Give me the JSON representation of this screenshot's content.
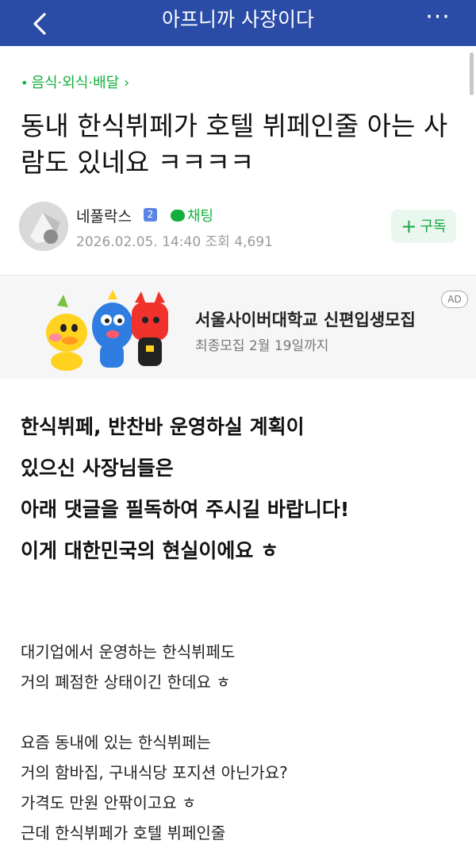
{
  "header": {
    "title": "아프니까 사장이다",
    "more_label": "···",
    "color": "#2a4ba6"
  },
  "post": {
    "category": "음식·외식·배달",
    "title": "동내 한식뷔페가 호텔 뷔페인줄 아는 사람도 있네요 ㅋㅋㅋㅋ",
    "author": "네풀락스",
    "level": "2",
    "chat_label": "채팅",
    "datetime": "2026.02.05. 14:40",
    "views_label": "조회",
    "views": "4,691",
    "subscribe_label": "구독"
  },
  "ad": {
    "title": "서울사이버대학교 신편입생모집",
    "subtitle": "최종모집 2월 19일까지",
    "badge": "AD"
  },
  "content": {
    "lead_lines": [
      "한식뷔페, 반찬바 운영하실 계획이",
      "있으신 사장님들은",
      "아래 댓글을 필독하여 주시길 바랍니다!",
      "이게 대한민국의 현실이에요 ㅎ"
    ],
    "paragraph1": [
      "대기업에서 운영하는 한식뷔페도",
      "거의 폐점한 상태이긴 한데요 ㅎ"
    ],
    "paragraph2": [
      "요즘 동내에 있는 한식뷔페는",
      "거의 함바집, 구내식당 포지션 아닌가요?",
      "가격도 만원 안팎이고요 ㅎ",
      "근데 한식뷔페가 호텔 뷔페인줄"
    ]
  },
  "colors": {
    "accent_green": "#12b03b",
    "header_blue": "#2a4ba6"
  }
}
